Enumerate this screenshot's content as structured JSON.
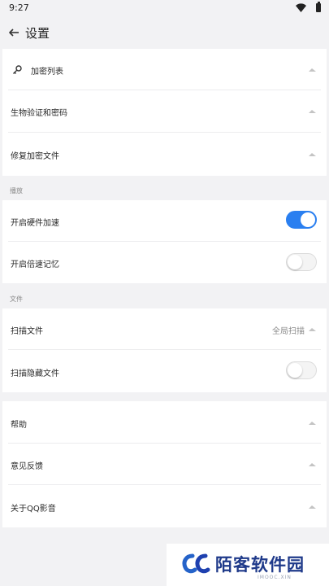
{
  "status_bar": {
    "time": "9:27"
  },
  "header": {
    "title": "设置"
  },
  "security_card": {
    "items": [
      {
        "label": "加密列表"
      },
      {
        "label": "生物验证和密码"
      },
      {
        "label": "修复加密文件"
      }
    ]
  },
  "playback": {
    "section_title": "播放",
    "items": [
      {
        "label": "开启硬件加速",
        "toggle_on": true
      },
      {
        "label": "开启倍速记忆",
        "toggle_on": false
      }
    ]
  },
  "files": {
    "section_title": "文件",
    "items": [
      {
        "label": "扫描文件",
        "value": "全局扫描"
      },
      {
        "label": "扫描隐藏文件",
        "toggle_on": false
      }
    ]
  },
  "about_card": {
    "items": [
      {
        "label": "帮助"
      },
      {
        "label": "意见反馈"
      },
      {
        "label": "关于QQ影音"
      }
    ]
  },
  "watermark": {
    "brand": "陌客软件园",
    "sub": "IMOOC.XIN"
  },
  "colors": {
    "accent": "#2a7ff0",
    "background": "#f2f2f4",
    "card": "#ffffff"
  }
}
